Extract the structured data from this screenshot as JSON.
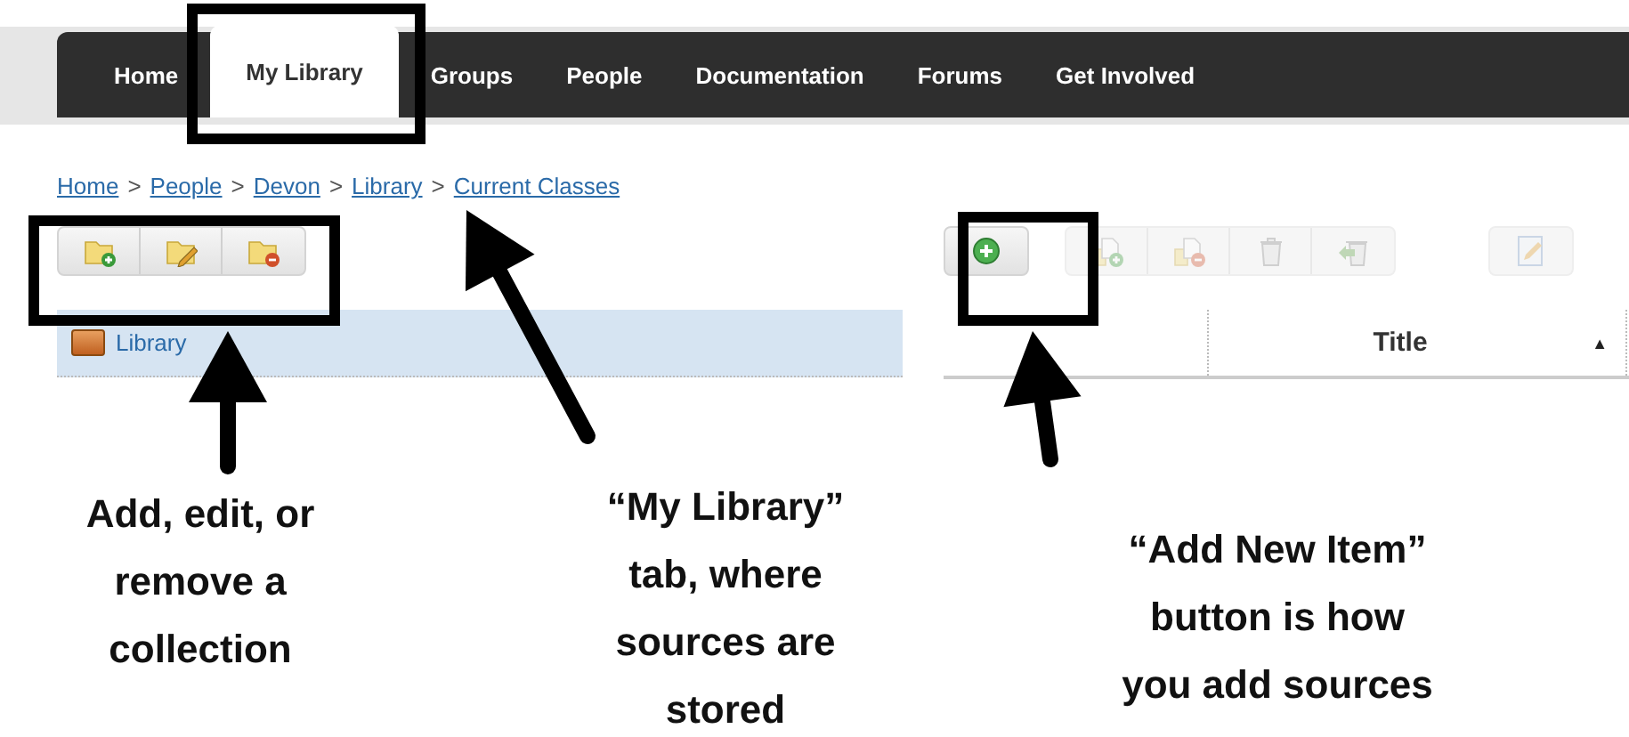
{
  "nav": {
    "tabs": [
      {
        "label": "Home",
        "selected": false
      },
      {
        "label": "My Library",
        "selected": true
      },
      {
        "label": "Groups",
        "selected": false
      },
      {
        "label": "People",
        "selected": false
      },
      {
        "label": "Documentation",
        "selected": false
      },
      {
        "label": "Forums",
        "selected": false
      },
      {
        "label": "Get Involved",
        "selected": false
      }
    ]
  },
  "breadcrumb": [
    {
      "label": "Home"
    },
    {
      "separator": ">",
      "label": "People"
    },
    {
      "separator": ">",
      "label": "Devon"
    },
    {
      "separator": ">",
      "label": "Library"
    },
    {
      "separator": ">",
      "label": "Current Classes"
    }
  ],
  "collection_toolbar": {
    "buttons": [
      {
        "kind": "add-collection",
        "disabled": false
      },
      {
        "kind": "edit-collection",
        "disabled": false
      },
      {
        "kind": "remove-collection",
        "disabled": false
      }
    ]
  },
  "item_toolbar": {
    "buttons": [
      {
        "kind": "add-item",
        "disabled": false
      },
      {
        "kind": "add-to-collection",
        "disabled": true
      },
      {
        "kind": "remove-from-collection",
        "disabled": true
      },
      {
        "kind": "trash",
        "disabled": true
      },
      {
        "kind": "restore",
        "disabled": true
      },
      {
        "kind": "edit",
        "disabled": true
      }
    ]
  },
  "collections": [
    {
      "label": "Library",
      "selected": true
    }
  ],
  "table": {
    "columns": [
      {
        "label": "Title",
        "sort_arrow": "▲"
      }
    ]
  },
  "annotations": [
    {
      "text": "Add, edit, or\nremove a\ncollection"
    },
    {
      "text": "“My Library”\ntab, where\nsources are\nstored"
    },
    {
      "text": "“Add New Item”\nbutton is how\nyou add sources"
    }
  ]
}
